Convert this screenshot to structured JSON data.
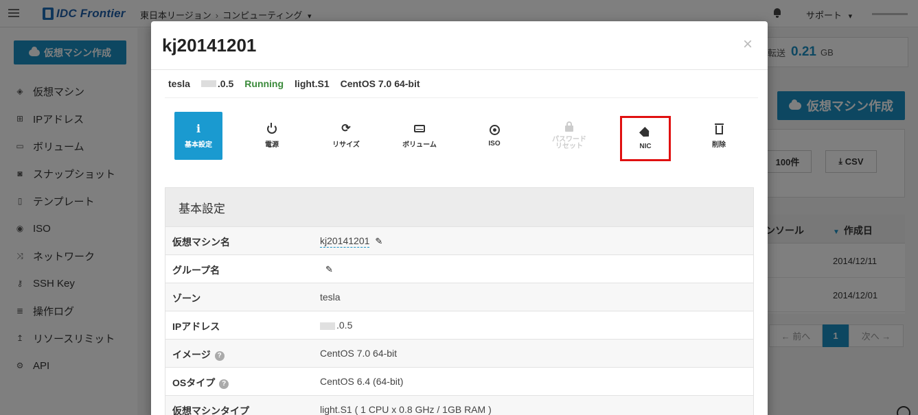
{
  "header": {
    "logo_text": "IDC Frontier",
    "breadcrumb_region": "東日本リージョン",
    "breadcrumb_section": "コンピューティング",
    "support_label": "サポート",
    "dropdown_caret": "▾"
  },
  "sidebar": {
    "create_button": "仮想マシン作成",
    "items": [
      {
        "label": "仮想マシン",
        "icon": "cube-icon"
      },
      {
        "label": "IPアドレス",
        "icon": "sitemap-icon"
      },
      {
        "label": "ボリューム",
        "icon": "hdd-icon"
      },
      {
        "label": "スナップショット",
        "icon": "camera-icon"
      },
      {
        "label": "テンプレート",
        "icon": "file-icon"
      },
      {
        "label": "ISO",
        "icon": "disc-icon"
      },
      {
        "label": "ネットワーク",
        "icon": "random-icon"
      },
      {
        "label": "SSH Key",
        "icon": "key-icon"
      },
      {
        "label": "操作ログ",
        "icon": "list-icon"
      },
      {
        "label": "リソースリミット",
        "icon": "resource-icon"
      },
      {
        "label": "API",
        "icon": "cogs-icon"
      }
    ]
  },
  "background": {
    "transfer_label": "転送",
    "transfer_value": "0.21",
    "transfer_unit": "GB",
    "create_button": "仮想マシン作成",
    "per_page_button": "100件",
    "csv_button": "CSV",
    "col_console": "ンソール",
    "col_created": "作成日",
    "rows": [
      "2014/12/11",
      "2014/12/01"
    ],
    "pager_prev": "← 前へ",
    "pager_current": "1",
    "pager_next": "次へ →"
  },
  "modal": {
    "title": "kj20141201",
    "close": "×",
    "summary": {
      "zone": "tesla",
      "ip_suffix": ".0.5",
      "status": "Running",
      "type": "light.S1",
      "os": "CentOS 7.0 64-bit"
    },
    "actions": [
      {
        "label": "基本設定",
        "icon": "info-icon",
        "state": "active"
      },
      {
        "label": "電源",
        "icon": "power-icon",
        "state": "normal"
      },
      {
        "label": "リサイズ",
        "icon": "refresh-icon",
        "state": "normal"
      },
      {
        "label": "ボリューム",
        "icon": "hdd-icon",
        "state": "normal"
      },
      {
        "label": "ISO",
        "icon": "disc-icon",
        "state": "normal"
      },
      {
        "label": "パスワード\nリセット",
        "icon": "lock-icon",
        "state": "disabled"
      },
      {
        "label": "NIC",
        "icon": "tag-icon",
        "state": "highlighted"
      },
      {
        "label": "削除",
        "icon": "trash-icon",
        "state": "normal"
      }
    ],
    "panel_title": "基本設定",
    "rows": [
      {
        "key": "仮想マシン名",
        "value": "kj20141201"
      },
      {
        "key": "グループ名",
        "value": ""
      },
      {
        "key": "ゾーン",
        "value": "tesla"
      },
      {
        "key": "IPアドレス",
        "value": ".0.5"
      },
      {
        "key": "イメージ",
        "value": "CentOS 7.0 64-bit"
      },
      {
        "key": "OSタイプ",
        "value": "CentOS 6.4 (64-bit)"
      },
      {
        "key": "仮想マシンタイプ",
        "value": "light.S1 ( 1 CPU x 0.8 GHz / 1GB RAM )"
      }
    ]
  },
  "colors": {
    "accent": "#1a8fc2",
    "running": "#3a8a3a",
    "highlight_box": "#e01010"
  }
}
